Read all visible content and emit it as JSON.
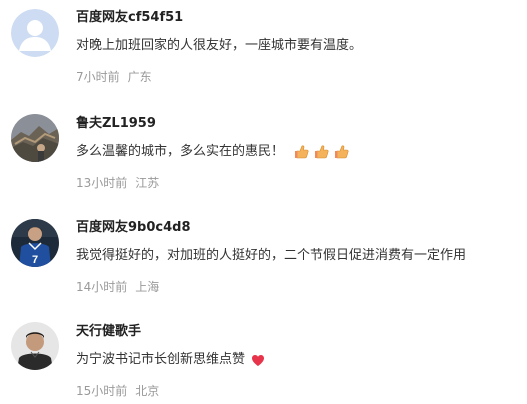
{
  "comments": [
    {
      "username": "百度网友cf54f51",
      "text": "对晚上加班回家的人很友好，一座城市要有温度。",
      "time": "7小时前",
      "location": "广东",
      "avatar_icon": "default-user-icon",
      "emojis": []
    },
    {
      "username": "鲁夫ZL1959",
      "text": "多么温馨的城市，多么实在的惠民！",
      "time": "13小时前",
      "location": "江苏",
      "avatar_icon": "great-wall-photo",
      "emojis": [
        "thumbs-up-icon",
        "thumbs-up-icon",
        "thumbs-up-icon"
      ]
    },
    {
      "username": "百度网友9b0c4d8",
      "text": "我觉得挺好的，对加班的人挺好的，二个节假日促进消费有一定作用",
      "time": "14小时前",
      "location": "上海",
      "avatar_icon": "football-player-photo",
      "avatar_jersey": "7",
      "emojis": []
    },
    {
      "username": "天行健歌手",
      "text": "为宁波书记市长创新思维点赞",
      "time": "15小时前",
      "location": "北京",
      "avatar_icon": "man-portrait-photo",
      "emojis": [
        "heart-icon"
      ]
    }
  ],
  "colors": {
    "meta_text": "#9a9a9a",
    "heart": "#e8344a",
    "default_avatar_bg": "#c9d8f0"
  }
}
